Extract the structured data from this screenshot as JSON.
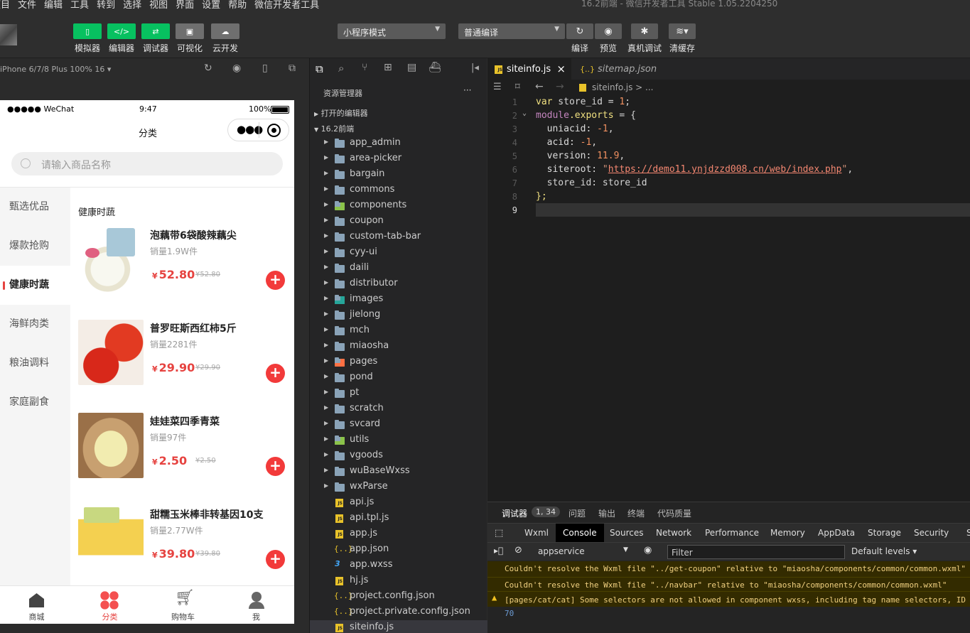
{
  "menubar": {
    "items": [
      "项目",
      "文件",
      "编辑",
      "工具",
      "转到",
      "选择",
      "视图",
      "界面",
      "设置",
      "帮助",
      "微信开发者工具"
    ],
    "window_title": "16.2前端 - 微信开发者工具 Stable 1.05.2204250"
  },
  "toolbar": {
    "left_buttons": [
      {
        "label": "模拟器",
        "icon": "phone-icon"
      },
      {
        "label": "编辑器",
        "icon": "code-icon"
      },
      {
        "label": "调试器",
        "icon": "debug-icon"
      },
      {
        "label": "可视化",
        "icon": "layout-icon"
      },
      {
        "label": "云开发",
        "icon": "cloud-icon"
      }
    ],
    "mode_select": "小程序模式",
    "compile_select": "普通编译",
    "right_buttons": [
      {
        "label": "编译",
        "icon": "refresh-icon"
      },
      {
        "label": "预览",
        "icon": "eye-icon"
      },
      {
        "label": "真机调试",
        "icon": "bug-icon"
      },
      {
        "label": "清缓存",
        "icon": "layers-icon"
      }
    ]
  },
  "simulator": {
    "device": "iPhone 6/7/8 Plus 100% 16 ▾",
    "status": {
      "carrier": "●●●●● WeChat",
      "time": "9:47",
      "battery": "100%"
    },
    "nav_title": "分类",
    "search_placeholder": "请输入商品名称",
    "categories": [
      "甄选优品",
      "爆款抢购",
      "健康时蔬",
      "海鲜肉类",
      "粮油调料",
      "家庭副食"
    ],
    "active_category": "健康时蔬",
    "section_title": "健康时蔬",
    "products": [
      {
        "name": "泡藕带6袋酸辣藕尖",
        "sales": "销量1.9W件",
        "price": "52.80",
        "orig": "¥52.80"
      },
      {
        "name": "普罗旺斯西红柿5斤",
        "sales": "销量2281件",
        "price": "29.90",
        "orig": "¥29.90"
      },
      {
        "name": "娃娃菜四季青菜",
        "sales": "销量97件",
        "price": "2.50",
        "orig": "¥2.50"
      },
      {
        "name": "甜糯玉米棒非转基因10支",
        "sales": "销量2.77W件",
        "price": "39.80",
        "orig": "¥39.80"
      }
    ],
    "currency": "¥",
    "tabs": [
      {
        "label": "商城",
        "icon": "home-icon"
      },
      {
        "label": "分类",
        "icon": "category-icon"
      },
      {
        "label": "购物车",
        "icon": "cart-icon"
      },
      {
        "label": "我",
        "icon": "user-icon"
      }
    ]
  },
  "explorer": {
    "title": "资源管理器",
    "more": "···",
    "open_editors": "打开的编辑器",
    "project": "16.2前端",
    "folders": [
      "app_admin",
      "area-picker",
      "bargain",
      "commons",
      "components",
      "coupon",
      "custom-tab-bar",
      "cyy-ui",
      "daili",
      "distributor",
      "images",
      "jielong",
      "mch",
      "miaosha",
      "pages",
      "pond",
      "pt",
      "scratch",
      "svcard",
      "utils",
      "vgoods",
      "wuBaseWxss",
      "wxParse"
    ],
    "files": [
      {
        "name": "api.js",
        "type": "js"
      },
      {
        "name": "api.tpl.js",
        "type": "js"
      },
      {
        "name": "app.js",
        "type": "js"
      },
      {
        "name": "app.json",
        "type": "json"
      },
      {
        "name": "app.wxss",
        "type": "css"
      },
      {
        "name": "hj.js",
        "type": "js"
      },
      {
        "name": "project.config.json",
        "type": "json"
      },
      {
        "name": "project.private.config.json",
        "type": "json"
      },
      {
        "name": "siteinfo.js",
        "type": "js"
      }
    ]
  },
  "editor": {
    "tabs": [
      {
        "name": "siteinfo.js",
        "active": true,
        "icon": "JS",
        "close": "×"
      },
      {
        "name": "sitemap.json",
        "active": false,
        "icon": "{..}"
      }
    ],
    "breadcrumb": "siteinfo.js > ...",
    "line_numbers": [
      "1",
      "2",
      "3",
      "4",
      "5",
      "6",
      "7",
      "8",
      "9"
    ],
    "code": {
      "l1_kw": "var",
      "l1_rest": " store_id = ",
      "l1_num": "1",
      "l1_end": ";",
      "l2_a": "module",
      "l2_b": ".exports",
      "l2_c": " = {",
      "l3_k": "  uniacid: ",
      "l3_v": "-1",
      "l3_e": ",",
      "l4_k": "  acid: ",
      "l4_v": "-1",
      "l4_e": ",",
      "l5_k": "  version: ",
      "l5_v": "11.9",
      "l5_e": ",",
      "l6_k": "  siteroot: ",
      "l6_q1": "\"",
      "l6_url": "https://demo11.ynjdzzd008.cn/web/index.php",
      "l6_q2": "\"",
      "l6_e": ",",
      "l7": "  store_id: store_id",
      "l8": "};"
    }
  },
  "devtools": {
    "tabs": [
      "调试器",
      "问题",
      "输出",
      "终端",
      "代码质量"
    ],
    "badge": "1, 34",
    "panels": [
      "Wxml",
      "Console",
      "Sources",
      "Network",
      "Performance",
      "Memory",
      "AppData",
      "Storage",
      "Security",
      "S"
    ],
    "active_panel": "Console",
    "context": "appservice",
    "filter_placeholder": "Filter",
    "levels": "Default levels ▾",
    "messages": [
      "Couldn't resolve the Wxml file \"../get-coupon\" relative to \"miaosha/components/common/common.wxml\"",
      "Couldn't resolve the Wxml file \"../navbar\" relative to \"miaosha/components/common/common.wxml\"",
      "[pages/cat/cat] Some selectors are not allowed in component wxss, including tag name selectors, ID s"
    ],
    "count": "70"
  },
  "colors": {
    "accent_green": "#07c160",
    "price_red": "#e64340",
    "editor_bg": "#1e1e1e"
  }
}
